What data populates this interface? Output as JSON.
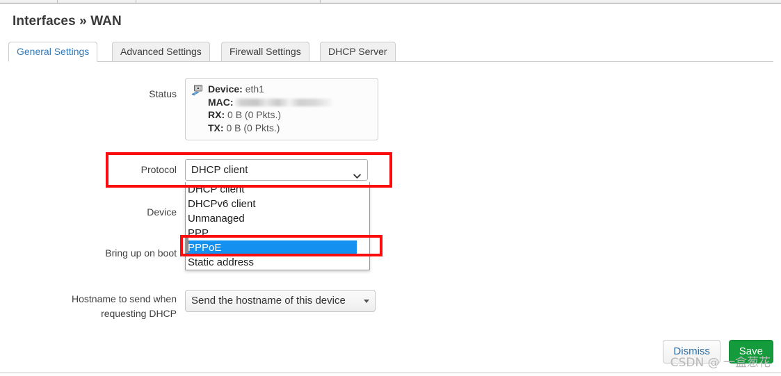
{
  "window": {
    "title": "Interfaces » WAN"
  },
  "tabs": [
    {
      "label": "General Settings",
      "active": true
    },
    {
      "label": "Advanced Settings",
      "active": false
    },
    {
      "label": "Firewall Settings",
      "active": false
    },
    {
      "label": "DHCP Server",
      "active": false
    }
  ],
  "form": {
    "status": {
      "label": "Status",
      "icon": "network-device-icon",
      "device_key": "Device:",
      "device_value": "eth1",
      "mac_key": "MAC:",
      "mac_value": "",
      "mac_redacted": true,
      "rx_key": "RX:",
      "rx_value": "0 B (0 Pkts.)",
      "tx_key": "TX:",
      "tx_value": "0 B (0 Pkts.)"
    },
    "protocol": {
      "label": "Protocol",
      "selected": "DHCP client",
      "expanded": true,
      "options": [
        "DHCP client",
        "DHCPv6 client",
        "Unmanaged",
        "PPP",
        "PPPoE",
        "Static address"
      ],
      "highlighted_option": "PPPoE"
    },
    "device": {
      "label": "Device"
    },
    "bring_up_on_boot": {
      "label": "Bring up on boot",
      "checked": false
    },
    "hostname": {
      "label_line1": "Hostname to send when",
      "label_line2": "requesting DHCP",
      "selected": "Send the hostname of this device"
    }
  },
  "footer": {
    "dismiss_label": "Dismiss",
    "save_label": "Save"
  },
  "watermark": {
    "text": "CSDN @ 一盒葱花"
  },
  "colors": {
    "annotation_red": "#fc0d0d",
    "option_highlight_blue": "#1490f0",
    "save_green": "#149b3c",
    "active_tab_blue": "#337ab7"
  }
}
